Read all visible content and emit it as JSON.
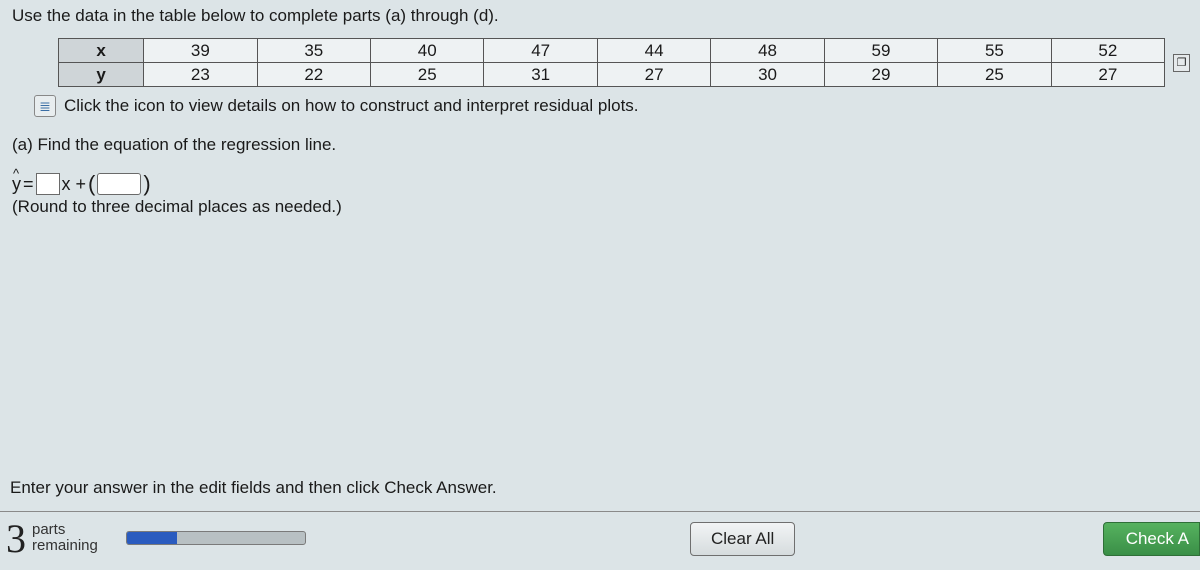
{
  "instruction": "Use the data in the table below to complete parts (a) through (d).",
  "table": {
    "rows": [
      {
        "label": "x",
        "values": [
          "39",
          "35",
          "40",
          "47",
          "44",
          "48",
          "59",
          "55",
          "52"
        ]
      },
      {
        "label": "y",
        "values": [
          "23",
          "22",
          "25",
          "31",
          "27",
          "30",
          "29",
          "25",
          "27"
        ]
      }
    ]
  },
  "help_text": "Click the icon to view details on how to construct and interpret residual plots.",
  "part_a": "(a) Find the equation of the regression line.",
  "equation": {
    "lhs": "y",
    "equals": " = ",
    "after_box1": "x + ",
    "paren_open": "(",
    "paren_close": ")"
  },
  "round_note": "(Round to three decimal places as needed.)",
  "enter_note": "Enter your answer in the edit fields and then click Check Answer.",
  "bottom": {
    "count": "3",
    "parts_label": "parts",
    "remaining_label": "remaining",
    "clear_all": "Clear All",
    "check": "Check A"
  },
  "icons": {
    "copy": "❐",
    "help": "≣",
    "hat": "^"
  }
}
